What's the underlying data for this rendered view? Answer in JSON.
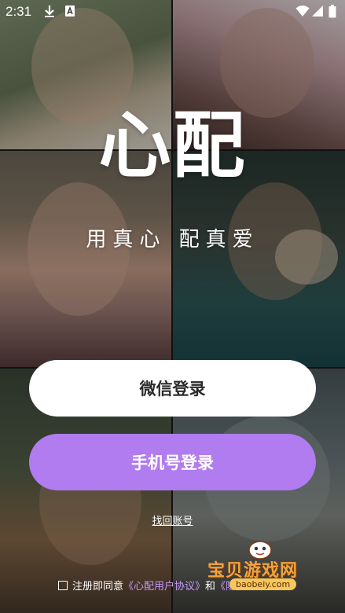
{
  "status_bar": {
    "time": "2:31",
    "icons": [
      "download-icon",
      "a-icon",
      "wifi-icon",
      "signal-icon",
      "battery-icon"
    ]
  },
  "logo": {
    "text": "心配"
  },
  "slogan": "用真心 配真爱",
  "buttons": {
    "wechat_label": "微信登录",
    "phone_label": "手机号登录"
  },
  "recover_link": "找回账号",
  "agreement": {
    "prefix": "注册即同意",
    "user_agreement": "《心配用户协议》",
    "conjunction": "和",
    "privacy": "《隐私政策》"
  },
  "watermark": {
    "title": "宝贝游戏网",
    "domain": "baobeiy.com"
  },
  "colors": {
    "primary_purple": "#b07cf0",
    "link_purple": "#c39af7",
    "white": "#ffffff"
  }
}
